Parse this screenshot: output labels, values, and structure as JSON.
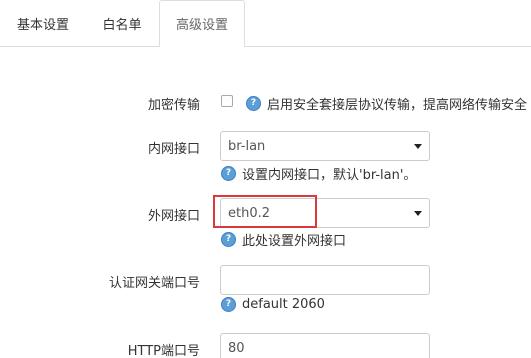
{
  "tabs": [
    {
      "label": "基本设置"
    },
    {
      "label": "白名单"
    },
    {
      "label": "高级设置"
    }
  ],
  "form": {
    "encryption": {
      "label": "加密传输",
      "checked": false,
      "help": "启用安全套接层协议传输，提高网络传输安全"
    },
    "lan_interface": {
      "label": "内网接口",
      "value": "br-lan",
      "help": "设置内网接口，默认'br-lan'。"
    },
    "wan_interface": {
      "label": "外网接口",
      "value": "eth0.2",
      "help": "此处设置外网接口"
    },
    "gateway_port": {
      "label": "认证网关端口号",
      "value": "",
      "help": "default 2060"
    },
    "http_port": {
      "label": "HTTP端口号",
      "value": "80"
    }
  },
  "icons": {
    "help": "question-circle-icon",
    "dropdown": "chevron-down-icon"
  },
  "colors": {
    "help_icon": "#5b9fd6",
    "highlight": "#d9393a",
    "border": "#cccccc"
  }
}
